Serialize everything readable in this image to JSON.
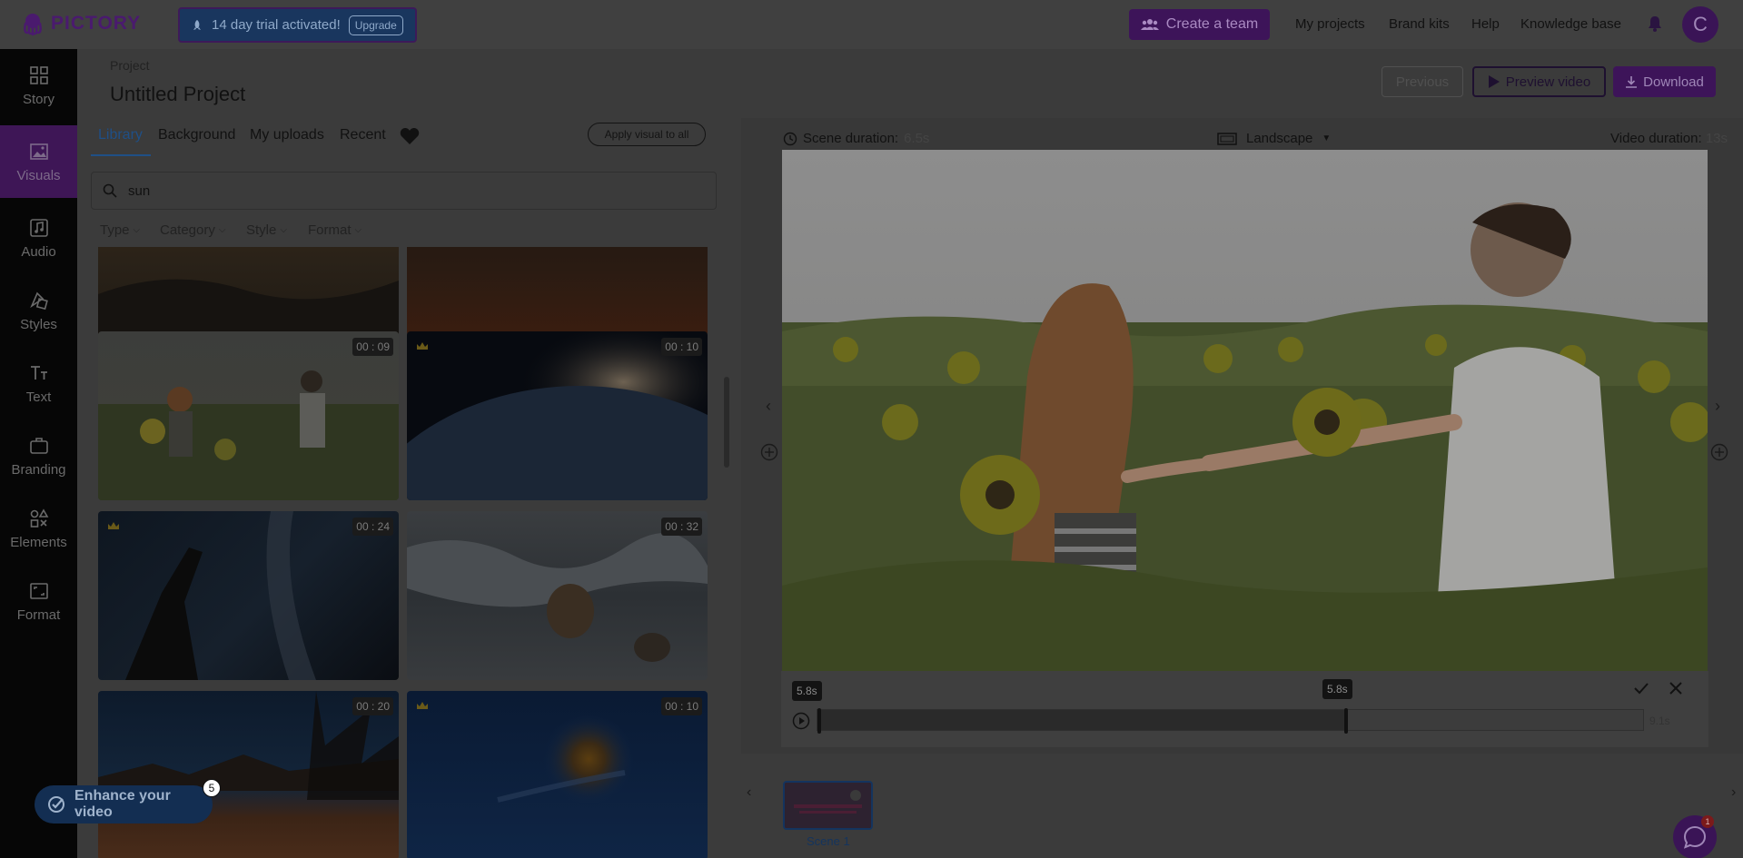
{
  "app": {
    "brand": "PICTORY"
  },
  "trial": {
    "text": "14 day trial activated!",
    "upgrade_label": "Upgrade"
  },
  "topnav": {
    "create_team": "Create a team",
    "my_projects": "My projects",
    "brand_kits": "Brand kits",
    "help": "Help",
    "knowledge_base": "Knowledge base",
    "avatar_initial": "C"
  },
  "sidebar": {
    "items": [
      {
        "label": "Story",
        "icon": "story-icon"
      },
      {
        "label": "Visuals",
        "icon": "image-icon",
        "active": true
      },
      {
        "label": "Audio",
        "icon": "music-icon"
      },
      {
        "label": "Styles",
        "icon": "styles-icon"
      },
      {
        "label": "Text",
        "icon": "text-icon"
      },
      {
        "label": "Branding",
        "icon": "briefcase-icon"
      },
      {
        "label": "Elements",
        "icon": "elements-icon"
      },
      {
        "label": "Format",
        "icon": "format-icon"
      }
    ]
  },
  "project": {
    "label": "Project",
    "title": "Untitled Project"
  },
  "header_actions": {
    "previous": "Previous",
    "preview": "Preview video",
    "download": "Download"
  },
  "library": {
    "tabs": [
      "Library",
      "Background",
      "My uploads",
      "Recent"
    ],
    "apply_all": "Apply visual to all",
    "search_value": "sun",
    "filters": [
      "Type",
      "Category",
      "Style",
      "Format"
    ],
    "thumbnails": [
      {
        "duration": "",
        "premium": false,
        "scene": "sunset-hills"
      },
      {
        "duration": "",
        "premium": false,
        "scene": "sunset-dark"
      },
      {
        "duration": "00 : 09",
        "premium": false,
        "scene": "sunflower-couple"
      },
      {
        "duration": "00 : 10",
        "premium": true,
        "scene": "earth-sunrise"
      },
      {
        "duration": "00 : 24",
        "premium": true,
        "scene": "hand-sun"
      },
      {
        "duration": "00 : 32",
        "premium": false,
        "scene": "ocean-waves"
      },
      {
        "duration": "00 : 20",
        "premium": false,
        "scene": "desert-road"
      },
      {
        "duration": "00 : 10",
        "premium": true,
        "scene": "blue-sun"
      }
    ],
    "enhance_label": "Enhance your video",
    "enhance_count": "5"
  },
  "preview": {
    "scene_duration_label": "Scene duration:",
    "scene_duration_value": "6.5s",
    "orientation": "Landscape",
    "video_duration_label": "Video duration:",
    "video_duration_value": "13s",
    "trim": {
      "start_label": "5.8s",
      "handle_label": "5.8s",
      "end_label": "9.1s",
      "fill_fraction": 0.64
    },
    "scene_label": "Scene 1",
    "chat_badge": "1"
  },
  "colors": {
    "accent": "#3d1459",
    "link": "#1f4f86",
    "background": "#3b3b3b"
  }
}
